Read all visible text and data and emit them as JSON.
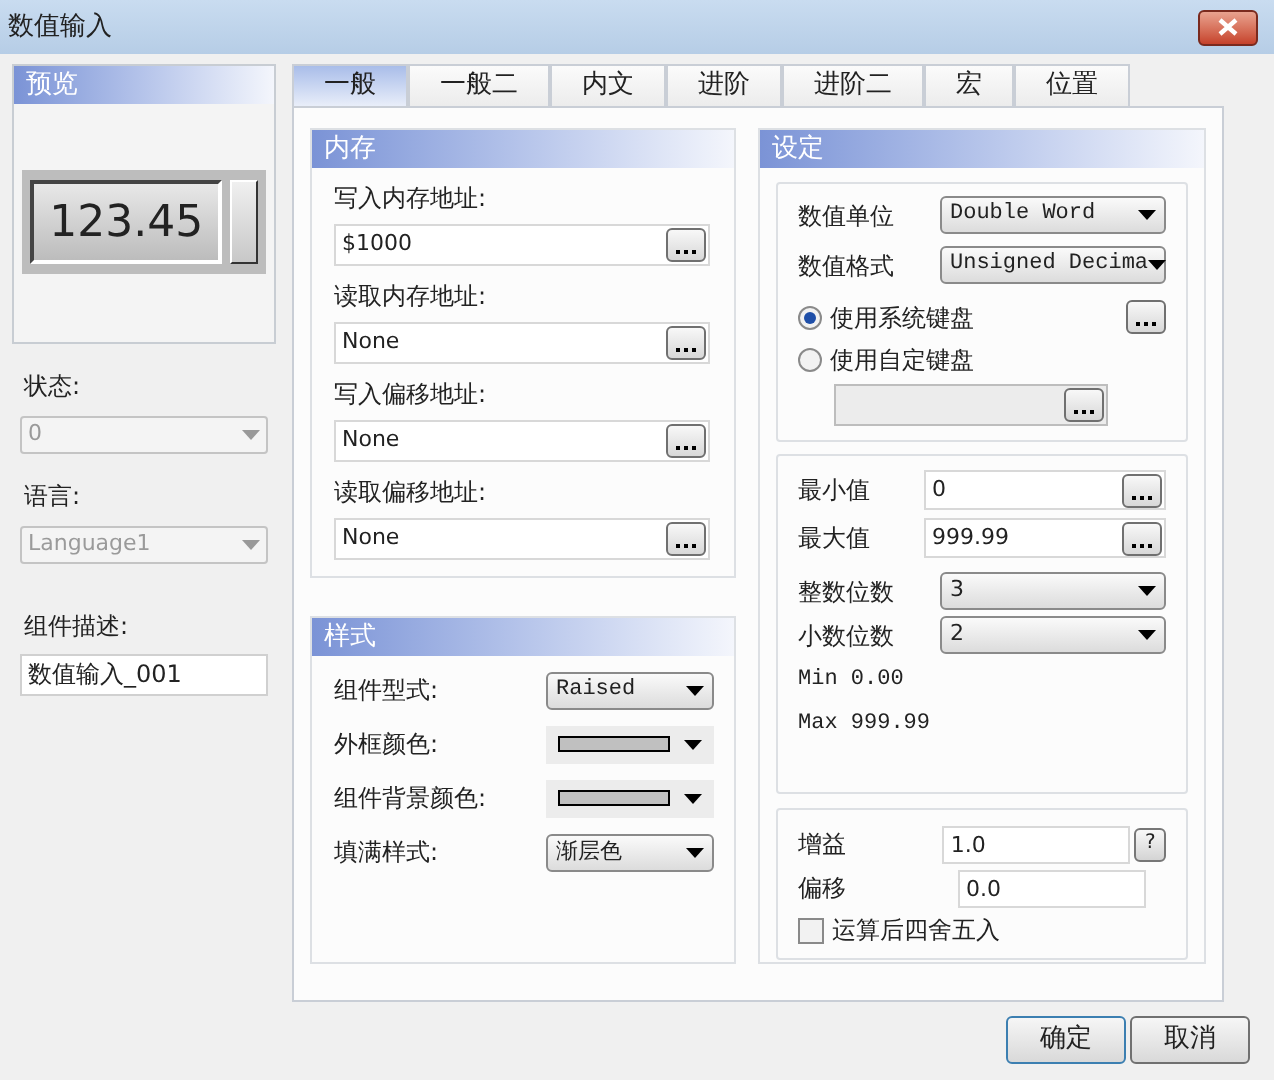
{
  "window": {
    "title": "数值输入"
  },
  "preview": {
    "title": "预览",
    "value": "123.45"
  },
  "left": {
    "fields": [
      {
        "label": "状态:",
        "value": "0",
        "disabled": true
      },
      {
        "label": "语言:",
        "value": "Language1",
        "disabled": true
      }
    ],
    "description": {
      "label": "组件描述:",
      "value": "数值输入_001"
    }
  },
  "tabs": [
    {
      "label": "一般",
      "selected": true
    },
    {
      "label": "一般二",
      "selected": false
    },
    {
      "label": "内文",
      "selected": false
    },
    {
      "label": "进阶",
      "selected": false
    },
    {
      "label": "进阶二",
      "selected": false
    },
    {
      "label": "宏",
      "selected": false
    },
    {
      "label": "位置",
      "selected": false
    }
  ],
  "memory": {
    "title": "内存",
    "fields": [
      {
        "label": "写入内存地址:",
        "value": "$1000"
      },
      {
        "label": "读取内存地址:",
        "value": "None"
      },
      {
        "label": "写入偏移地址:",
        "value": "None"
      },
      {
        "label": "读取偏移地址:",
        "value": "None"
      }
    ]
  },
  "style": {
    "title": "样式",
    "rows": [
      {
        "label": "组件型式:",
        "kind": "select",
        "value": "Raised"
      },
      {
        "label": "外框颜色:",
        "kind": "color"
      },
      {
        "label": "组件背景颜色:",
        "kind": "color"
      },
      {
        "label": "填满样式:",
        "kind": "select",
        "value": "渐层色"
      }
    ]
  },
  "settings": {
    "title": "设定",
    "selects": [
      {
        "label": "数值单位",
        "value": "Double Word"
      },
      {
        "label": "数值格式",
        "value": "Unsigned Decima"
      }
    ],
    "keyboards": [
      {
        "label": "使用系统键盘",
        "selected": true
      },
      {
        "label": "使用自定键盘",
        "selected": false
      }
    ],
    "limits": [
      {
        "label": "最小值",
        "value": "0"
      },
      {
        "label": "最大值",
        "value": "999.99"
      }
    ],
    "digits": [
      {
        "label": "整数位数",
        "value": "3"
      },
      {
        "label": "小数位数",
        "value": "2"
      }
    ],
    "range": [
      "Min 0.00",
      "Max 999.99"
    ],
    "gain": {
      "label": "增益",
      "value": "1.0",
      "help": "?"
    },
    "offset": {
      "label": "偏移",
      "value": "0.0"
    },
    "rounding": {
      "label": "运算后四舍五入",
      "checked": false
    }
  },
  "buttons": [
    "确定",
    "取消"
  ]
}
